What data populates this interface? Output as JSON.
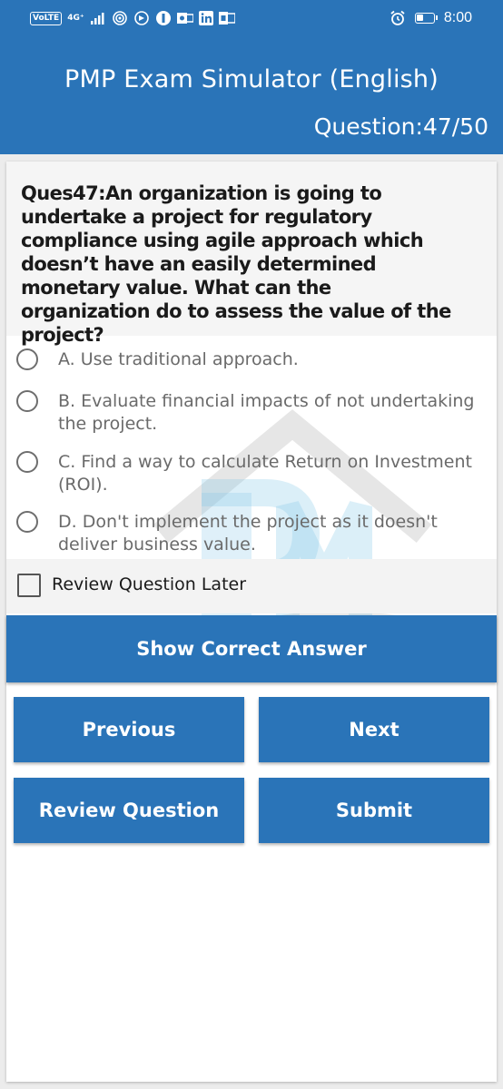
{
  "status_bar": {
    "network_badges": [
      "VoLTE",
      "4G⁺"
    ],
    "time": "8:00",
    "icons": [
      "signal-icon",
      "hotspot-icon",
      "location-icon",
      "app-icon",
      "outlook-icon",
      "linkedin-icon",
      "office-icon",
      "alarm-icon",
      "battery-icon"
    ]
  },
  "header": {
    "title": "PMP Exam Simulator (English)",
    "counter": "Question:47/50"
  },
  "question": {
    "text": "Ques47:An organization is going to undertake a project for regulatory compliance using agile approach which doesn’t have an easily determined monetary value. What can the organization do to assess the value of the project?",
    "options": [
      {
        "label": "A. Use traditional approach."
      },
      {
        "label": "B. Evaluate financial impacts of not undertaking the project."
      },
      {
        "label": "C. Find a way to calculate Return on Investment (ROI)."
      },
      {
        "label": "D. Don't implement the project as it doesn't deliver business value."
      }
    ]
  },
  "review": {
    "label": "Review Question Later",
    "checked": false
  },
  "buttons": {
    "show_answer": "Show Correct Answer",
    "previous": "Previous",
    "next": "Next",
    "review_question": "Review Question",
    "submit": "Submit"
  },
  "colors": {
    "primary": "#2a74b8",
    "background": "#ececec"
  }
}
